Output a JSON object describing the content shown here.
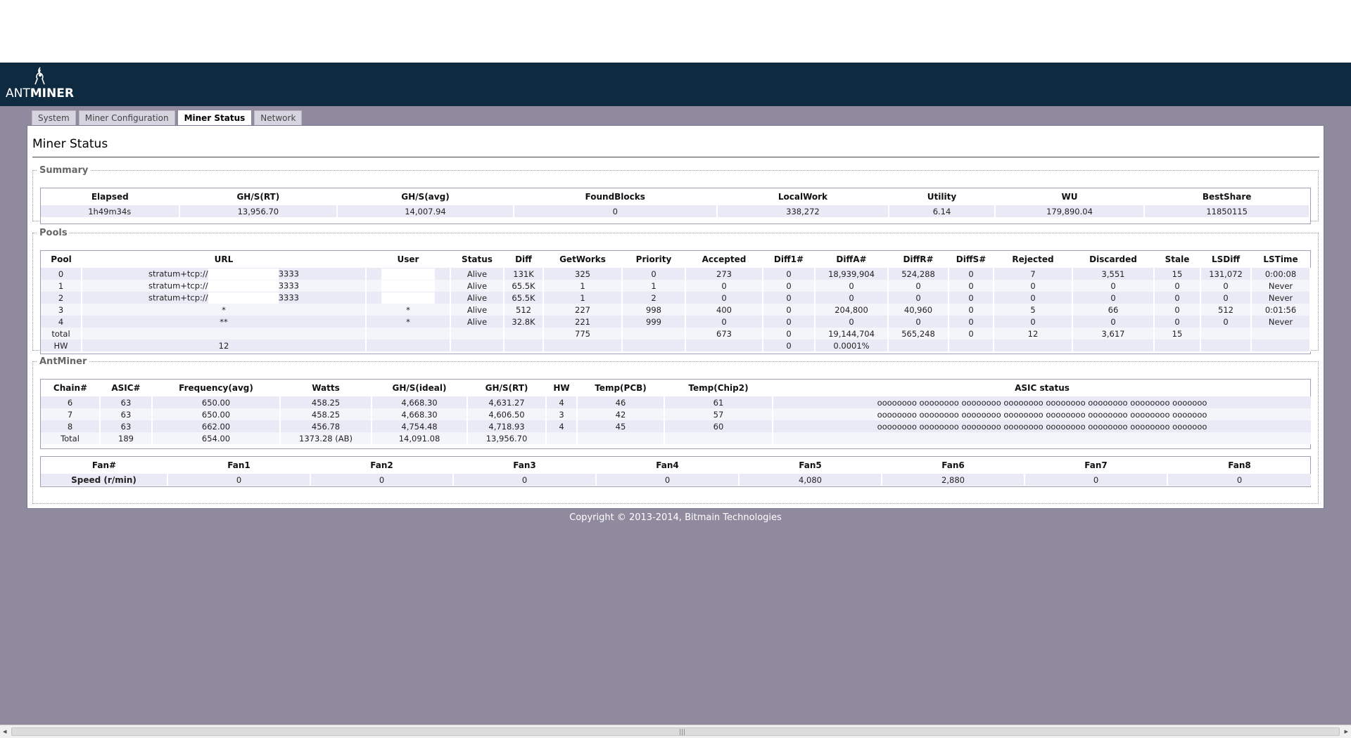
{
  "brand": {
    "word_thin": "ANT",
    "word_bold": "MINER"
  },
  "tabs": [
    {
      "label": "System"
    },
    {
      "label": "Miner Configuration"
    },
    {
      "label": "Miner Status"
    },
    {
      "label": "Network"
    }
  ],
  "active_tab": "Miner Status",
  "page_title": "Miner Status",
  "summary": {
    "legend": "Summary",
    "headers": [
      "Elapsed",
      "GH/S(RT)",
      "GH/S(avg)",
      "FoundBlocks",
      "LocalWork",
      "Utility",
      "WU",
      "BestShare"
    ],
    "rows": [
      [
        "1h49m34s",
        "13,956.70",
        "14,007.94",
        "0",
        "338,272",
        "6.14",
        "179,890.04",
        "11850115"
      ]
    ]
  },
  "pools": {
    "legend": "Pools",
    "headers": [
      "Pool",
      "URL",
      "User",
      "Status",
      "Diff",
      "GetWorks",
      "Priority",
      "Accepted",
      "Diff1#",
      "DiffA#",
      "DiffR#",
      "DiffS#",
      "Rejected",
      "Discarded",
      "Stale",
      "LSDiff",
      "LSTime"
    ],
    "rows": [
      {
        "pool": "0",
        "url_prefix": "stratum+tcp://",
        "url_suffix": "3333",
        "redacted": true,
        "user": "",
        "status": "Alive",
        "diff": "131K",
        "getworks": "325",
        "priority": "0",
        "accepted": "273",
        "diff1": "0",
        "diffa": "18,939,904",
        "diffr": "524,288",
        "diffs": "0",
        "rejected": "7",
        "discarded": "3,551",
        "stale": "15",
        "lsdiff": "131,072",
        "lstime": "0:00:08"
      },
      {
        "pool": "1",
        "url_prefix": "stratum+tcp://",
        "url_suffix": "3333",
        "redacted": true,
        "user": "",
        "status": "Alive",
        "diff": "65.5K",
        "getworks": "1",
        "priority": "1",
        "accepted": "0",
        "diff1": "0",
        "diffa": "0",
        "diffr": "0",
        "diffs": "0",
        "rejected": "0",
        "discarded": "0",
        "stale": "0",
        "lsdiff": "0",
        "lstime": "Never"
      },
      {
        "pool": "2",
        "url_prefix": "stratum+tcp://",
        "url_suffix": "3333",
        "redacted": true,
        "user": "",
        "status": "Alive",
        "diff": "65.5K",
        "getworks": "1",
        "priority": "2",
        "accepted": "0",
        "diff1": "0",
        "diffa": "0",
        "diffr": "0",
        "diffs": "0",
        "rejected": "0",
        "discarded": "0",
        "stale": "0",
        "lsdiff": "0",
        "lstime": "Never"
      },
      {
        "pool": "3",
        "url_prefix": "*",
        "url_suffix": "",
        "redacted": false,
        "user": "*",
        "status": "Alive",
        "diff": "512",
        "getworks": "227",
        "priority": "998",
        "accepted": "400",
        "diff1": "0",
        "diffa": "204,800",
        "diffr": "40,960",
        "diffs": "0",
        "rejected": "5",
        "discarded": "66",
        "stale": "0",
        "lsdiff": "512",
        "lstime": "0:01:56"
      },
      {
        "pool": "4",
        "url_prefix": "**",
        "url_suffix": "",
        "redacted": false,
        "user": "*",
        "status": "Alive",
        "diff": "32.8K",
        "getworks": "221",
        "priority": "999",
        "accepted": "0",
        "diff1": "0",
        "diffa": "0",
        "diffr": "0",
        "diffs": "0",
        "rejected": "0",
        "discarded": "0",
        "stale": "0",
        "lsdiff": "0",
        "lstime": "Never"
      },
      {
        "pool": "total",
        "url_prefix": "",
        "url_suffix": "",
        "redacted": false,
        "user": "",
        "status": "",
        "diff": "",
        "getworks": "775",
        "priority": "",
        "accepted": "673",
        "diff1": "0",
        "diffa": "19,144,704",
        "diffr": "565,248",
        "diffs": "0",
        "rejected": "12",
        "discarded": "3,617",
        "stale": "15",
        "lsdiff": "",
        "lstime": ""
      },
      {
        "pool": "HW",
        "url_prefix": "12",
        "url_suffix": "",
        "redacted": false,
        "user": "",
        "status": "",
        "diff": "",
        "getworks": "",
        "priority": "",
        "accepted": "",
        "diff1": "0",
        "diffa": "0.0001%",
        "diffr": "",
        "diffs": "",
        "rejected": "",
        "discarded": "",
        "stale": "",
        "lsdiff": "",
        "lstime": ""
      }
    ]
  },
  "antminer": {
    "legend": "AntMiner",
    "headers": [
      "Chain#",
      "ASIC#",
      "Frequency(avg)",
      "Watts",
      "GH/S(ideal)",
      "GH/S(RT)",
      "HW",
      "Temp(PCB)",
      "Temp(Chip2)",
      "ASIC status"
    ],
    "rows": [
      [
        "6",
        "63",
        "650.00",
        "458.25",
        "4,668.30",
        "4,631.27",
        "4",
        "46",
        "61",
        "oooooooo oooooooo oooooooo oooooooo oooooooo oooooooo oooooooo ooooooo"
      ],
      [
        "7",
        "63",
        "650.00",
        "458.25",
        "4,668.30",
        "4,606.50",
        "3",
        "42",
        "57",
        "oooooooo oooooooo oooooooo oooooooo oooooooo oooooooo oooooooo ooooooo"
      ],
      [
        "8",
        "63",
        "662.00",
        "456.78",
        "4,754.48",
        "4,718.93",
        "4",
        "45",
        "60",
        "oooooooo oooooooo oooooooo oooooooo oooooooo oooooooo oooooooo ooooooo"
      ],
      [
        "Total",
        "189",
        "654.00",
        "1373.28 (AB)",
        "14,091.08",
        "13,956.70",
        "",
        "",
        "",
        ""
      ]
    ]
  },
  "fans": {
    "headers": [
      "Fan#",
      "Fan1",
      "Fan2",
      "Fan3",
      "Fan4",
      "Fan5",
      "Fan6",
      "Fan7",
      "Fan8"
    ],
    "row_label": "Speed (r/min)",
    "values": [
      "0",
      "0",
      "0",
      "0",
      "4,080",
      "2,880",
      "0",
      "0"
    ]
  },
  "copyright": "Copyright © 2013-2014, Bitmain Technologies",
  "scrollbar": {
    "left_arrow": "◂",
    "right_arrow": "▸",
    "grip": "|||"
  }
}
